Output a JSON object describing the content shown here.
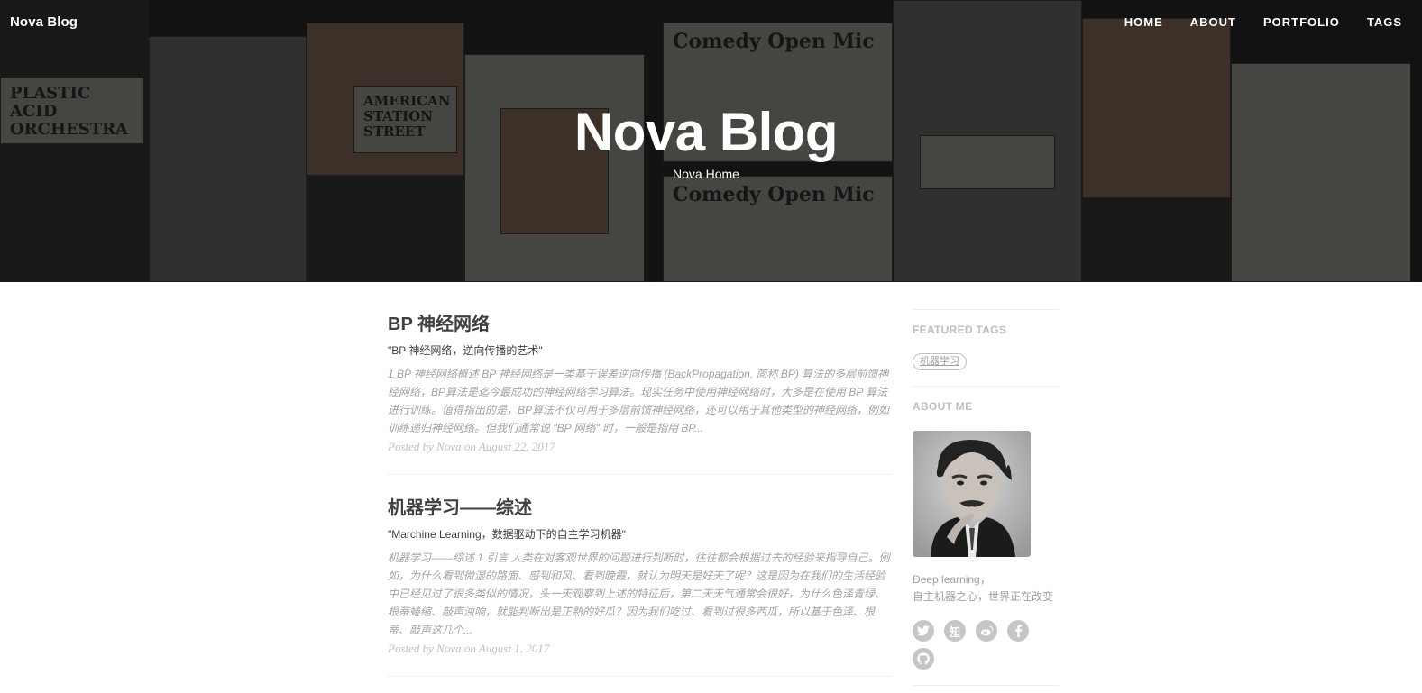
{
  "header": {
    "brand": "Nova Blog",
    "nav": [
      "HOME",
      "ABOUT",
      "PORTFOLIO",
      "TAGS"
    ],
    "title": "Nova Blog",
    "subtitle": "Nova Home",
    "poster_texts": [
      "Comedy Open Mic",
      "PLASTIC ACID ORCHESTRA",
      "AMERICAN STATION STREET",
      "Comedy Open Mic"
    ]
  },
  "posts": [
    {
      "title": "BP 神经网络",
      "subtitle": "\"BP 神经网络，逆向传播的艺术\"",
      "excerpt": "1 BP 神经网络概述 BP 神经网络是一类基于误差逆向传播 (BackPropagation, 简称 BP) 算法的多层前馈神经网络，BP算法是迄今最成功的神经网络学习算法。现实任务中使用神经网络时，大多是在使用 BP 算法进行训练。值得指出的是，BP算法不仅可用于多层前馈神经网络，还可以用于其他类型的神经网络，例如训练递归神经网络。但我们通常说 \"BP 网络\" 时，一般是指用 BP...",
      "meta": "Posted by Nova on August 22, 2017"
    },
    {
      "title": "机器学习——综述",
      "subtitle": "\"Marchine Learning，数据驱动下的自主学习机器\"",
      "excerpt": "机器学习——综述 1 引言 人类在对客观世界的问题进行判断时，往往都会根据过去的经验来指导自己。例如，为什么看到微湿的路面、感到和风、看到晚霞，就认为明天是好天了呢？这是因为在我们的生活经验中已经见过了很多类似的情况，头一天观察到上述的特征后，第二天天气通常会很好，为什么色泽青绿、根蒂蜷缩、敲声浊响，就能判断出是正熟的好瓜？因为我们吃过、看到过很多西瓜，所以基于色泽、根蒂、敲声这几个...",
      "meta": "Posted by Nova on August 1, 2017"
    }
  ],
  "sidebar": {
    "featured_tags_heading": "FEATURED TAGS",
    "tags": [
      "机器学习"
    ],
    "about_heading": "ABOUT ME",
    "about_line1": "Deep learning，",
    "about_line2": "自主机器之心，世界正在改变",
    "socials": [
      {
        "name": "twitter-icon",
        "glyph": "t"
      },
      {
        "name": "zhihu-icon",
        "glyph": "知"
      },
      {
        "name": "weibo-icon",
        "glyph": "w"
      },
      {
        "name": "facebook-icon",
        "glyph": "f"
      },
      {
        "name": "github-icon",
        "glyph": "g"
      }
    ]
  }
}
